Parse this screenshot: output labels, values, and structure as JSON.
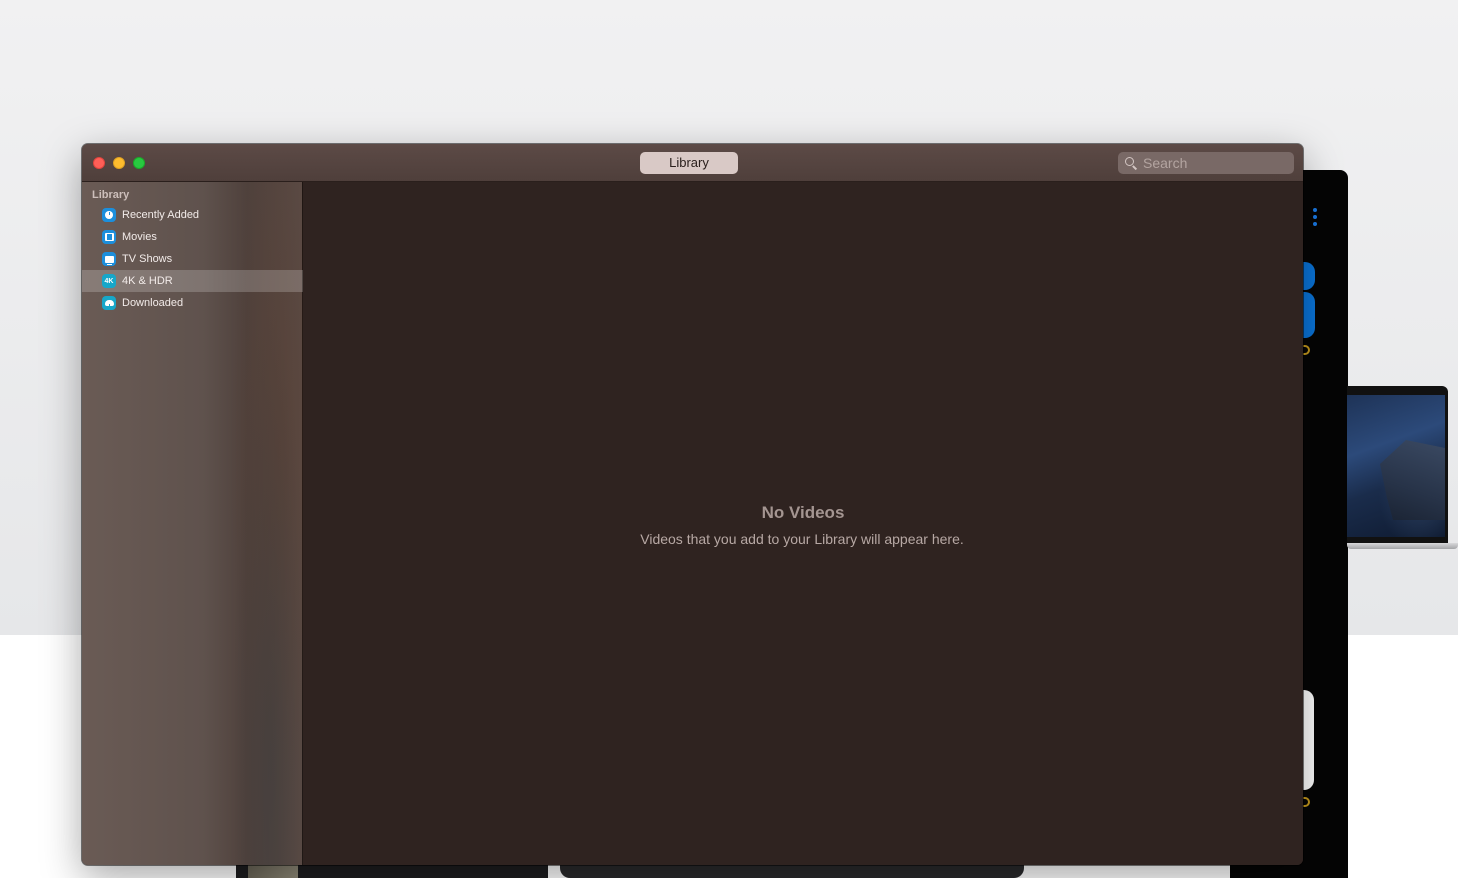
{
  "window": {
    "title_segment": "Library",
    "search": {
      "placeholder": "Search",
      "value": ""
    }
  },
  "sidebar": {
    "header": "Library",
    "items": [
      {
        "label": "Recently Added",
        "icon": "clock-icon",
        "selected": false
      },
      {
        "label": "Movies",
        "icon": "film-icon",
        "selected": false
      },
      {
        "label": "TV Shows",
        "icon": "tv-icon",
        "selected": false
      },
      {
        "label": "4K & HDR",
        "icon": "4k-icon",
        "icon_text": "4K",
        "selected": true
      },
      {
        "label": "Downloaded",
        "icon": "cloud-download-icon",
        "selected": false
      }
    ]
  },
  "content": {
    "empty_title": "No Videos",
    "empty_description": "Videos that you add to your Library will appear here."
  },
  "colors": {
    "window_bg": "#2f2320",
    "sidebar_selected": "rgba(255,255,255,0.2)",
    "traffic_close": "#fe5f57",
    "traffic_minimize": "#febc2e",
    "traffic_maximize": "#28c840",
    "icon_blue": "#1c8fdc",
    "icon_teal": "#17a7c9"
  }
}
